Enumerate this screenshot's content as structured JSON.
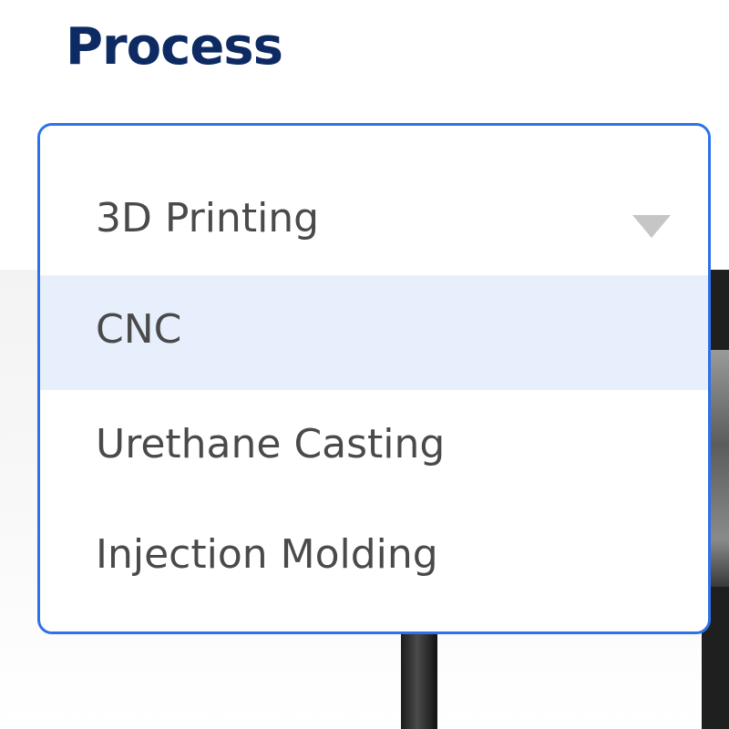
{
  "field": {
    "label": "Process"
  },
  "dropdown": {
    "selected_value": "3D Printing",
    "options": [
      {
        "label": "CNC",
        "highlighted": true
      },
      {
        "label": "Urethane Casting",
        "highlighted": false
      },
      {
        "label": "Injection Molding",
        "highlighted": false
      }
    ]
  },
  "colors": {
    "heading": "#0d2a63",
    "focus_border": "#2d72e8",
    "highlight_bg": "#e6effb",
    "text": "#4a4a4a",
    "chevron": "#c6c6c6"
  },
  "icons": {
    "chevron": "chevron-down-icon"
  }
}
